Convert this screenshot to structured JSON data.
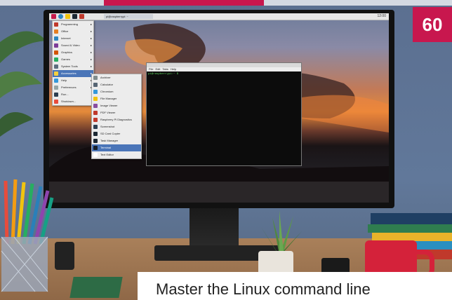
{
  "page_number": "60",
  "caption": "Master the Linux command line",
  "desktop": {
    "taskbar": {
      "window_button": "pi@raspberrypi: ~",
      "clock": "12:00"
    },
    "main_menu": {
      "items": [
        {
          "label": "Programming",
          "icon": "programming-icon",
          "color": "#c0392b",
          "submenu": true
        },
        {
          "label": "Office",
          "icon": "office-icon",
          "color": "#e67e22",
          "submenu": true
        },
        {
          "label": "Internet",
          "icon": "globe-icon",
          "color": "#2e86c1",
          "submenu": true
        },
        {
          "label": "Sound & Video",
          "icon": "sound-icon",
          "color": "#7d3c98",
          "submenu": true
        },
        {
          "label": "Graphics",
          "icon": "graphics-icon",
          "color": "#d35400",
          "submenu": true
        },
        {
          "label": "Games",
          "icon": "games-icon",
          "color": "#27ae60",
          "submenu": true
        },
        {
          "label": "System Tools",
          "icon": "tools-icon",
          "color": "#5d6d7e",
          "submenu": true
        },
        {
          "label": "Accessories",
          "icon": "accessories-icon",
          "color": "#f4d03f",
          "submenu": true,
          "selected": true
        },
        {
          "label": "Help",
          "icon": "help-icon",
          "color": "#3498db",
          "submenu": true
        },
        {
          "label": "Preferences",
          "icon": "preferences-icon",
          "color": "#95a5a6",
          "submenu": true
        },
        {
          "label": "Run...",
          "icon": "run-icon",
          "color": "#2c3e50",
          "submenu": false
        },
        {
          "label": "Shutdown...",
          "icon": "shutdown-icon",
          "color": "#e74c3c",
          "submenu": false
        }
      ]
    },
    "accessories_menu": {
      "items": [
        {
          "label": "Archiver",
          "icon": "archiver-icon",
          "color": "#7f8c8d"
        },
        {
          "label": "Calculator",
          "icon": "calculator-icon",
          "color": "#566573"
        },
        {
          "label": "Chromium",
          "icon": "chromium-icon",
          "color": "#3498db"
        },
        {
          "label": "File Manager",
          "icon": "folder-icon",
          "color": "#f1c40f"
        },
        {
          "label": "Image Viewer",
          "icon": "image-icon",
          "color": "#884ea0"
        },
        {
          "label": "PDF Viewer",
          "icon": "pdf-icon",
          "color": "#c0392b"
        },
        {
          "label": "Raspberry Pi Diagnostics",
          "icon": "raspberry-icon",
          "color": "#c0392b"
        },
        {
          "label": "Screenshot",
          "icon": "screenshot-icon",
          "color": "#2e4053"
        },
        {
          "label": "SD Card Copier",
          "icon": "sdcard-icon",
          "color": "#1c2833"
        },
        {
          "label": "Task Manager",
          "icon": "task-manager-icon",
          "color": "#1c2833"
        },
        {
          "label": "Terminal",
          "icon": "terminal-icon",
          "color": "#17202a",
          "selected": true
        },
        {
          "label": "Text Editor",
          "icon": "text-editor-icon",
          "color": "#fdfefe"
        }
      ]
    },
    "terminal": {
      "menu": [
        "File",
        "Edit",
        "Tabs",
        "Help"
      ],
      "prompt": "pi@raspberrypi:~ $"
    }
  }
}
